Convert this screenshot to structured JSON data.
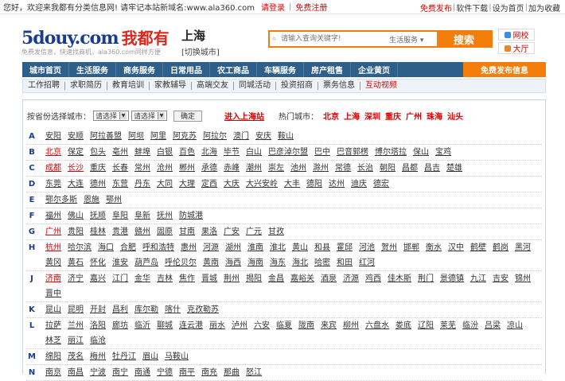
{
  "topbar": {
    "welcome": "您好，欢迎来我都有分类信息网! 请牢记本站新域名:www.ala360.com",
    "login": "请登录",
    "register": "免费注册",
    "links": [
      "免费发布",
      "软件下载",
      "设为首页",
      "加为收藏"
    ]
  },
  "logo": {
    "en": "5douy.com",
    "cn": "我都有",
    "slogan": "免费发信息，快速找商机，ala360.com同样方便"
  },
  "city": {
    "name": "上海",
    "switch": "[切换城市]"
  },
  "search": {
    "placeholder": "请输入查询关键字!",
    "select": "生活服务 ▾",
    "button": "搜索"
  },
  "side_links": {
    "school": "网校",
    "hall": "大厅"
  },
  "nav": {
    "items": [
      "城市首页",
      "生活服务",
      "商务服务",
      "日常用品",
      "农工商品",
      "车辆服务",
      "房产租售",
      "企业黄页"
    ],
    "free_publish": "免费发布信息"
  },
  "subnav": {
    "items": [
      "工作招聘",
      "求职简历",
      "教育培训",
      "家教辅导",
      "高端交友",
      "同城活动",
      "投资招商",
      "票务信息",
      "互动视频"
    ]
  },
  "province": {
    "label": "按省份选择城市：",
    "select1": "请选择",
    "select2": "请选择",
    "ok": "确定",
    "enter": "进入上海站",
    "hot_label": "热门城市：",
    "hot": [
      "北京",
      "上海",
      "深圳",
      "重庆",
      "广州",
      "珠海",
      "汕头"
    ]
  },
  "rows": [
    {
      "letter": "A",
      "cities": [
        "安阳",
        "安顺",
        "阿拉善盟",
        "阿坝",
        "阿里",
        "阿克苏",
        "阿拉尔",
        "澳门",
        "安庆",
        "鞍山"
      ],
      "hl": []
    },
    {
      "letter": "B",
      "cities": [
        "北京",
        "保定",
        "包头",
        "亳州",
        "蚌埠",
        "白银",
        "百色",
        "北海",
        "毕节",
        "白山",
        "巴彦淖尔盟",
        "巴中",
        "巴音郭楞",
        "博尔塔拉",
        "保山",
        "宝鸡"
      ],
      "hl": [
        0
      ]
    },
    {
      "letter": "C",
      "cities": [
        "成都",
        "长沙",
        "重庆",
        "长春",
        "常州",
        "沧州",
        "郴州",
        "承德",
        "赤峰",
        "潮州",
        "崇左",
        "池州",
        "滁州",
        "常德",
        "长治",
        "朝阳",
        "昌都",
        "昌吉",
        "楚雄"
      ],
      "hl": [
        0,
        1
      ]
    },
    {
      "letter": "D",
      "cities": [
        "东莞",
        "大连",
        "德州",
        "东营",
        "丹东",
        "大同",
        "大理",
        "定西",
        "大庆",
        "大兴安岭",
        "大丰",
        "德阳",
        "达州",
        "迪庆",
        "德宏"
      ],
      "hl": []
    },
    {
      "letter": "E",
      "cities": [
        "鄂尔多斯",
        "恩施",
        "鄂州"
      ],
      "hl": []
    },
    {
      "letter": "F",
      "cities": [
        "福州",
        "佛山",
        "抚顺",
        "阜阳",
        "阜新",
        "抚州",
        "防城港"
      ],
      "hl": []
    },
    {
      "letter": "G",
      "cities": [
        "广州",
        "贵阳",
        "桂林",
        "贵港",
        "赣州",
        "固原",
        "甘南",
        "果洛",
        "广安",
        "广元",
        "甘孜"
      ],
      "hl": [
        0
      ]
    },
    {
      "letter": "H",
      "cities": [
        "杭州",
        "哈尔滨",
        "海口",
        "合肥",
        "呼和浩特",
        "惠州",
        "河源",
        "湖州",
        "淮南",
        "淮北",
        "黄山",
        "和县",
        "霍邱",
        "河池",
        "贺州",
        "邯郸",
        "衡水",
        "汉中",
        "鹤壁",
        "鹤岗",
        "黑河",
        "黄冈",
        "黄石",
        "怀化",
        "淮安",
        "葫芦岛",
        "呼伦贝尔",
        "黄南",
        "海西",
        "海南",
        "海东",
        "海北",
        "哈密",
        "和田",
        "红河"
      ],
      "hl": [
        0
      ]
    },
    {
      "letter": "J",
      "cities": [
        "济南",
        "济宁",
        "嘉兴",
        "江门",
        "金华",
        "吉林",
        "焦作",
        "晋城",
        "荆州",
        "揭阳",
        "金昌",
        "嘉峪关",
        "酒泉",
        "济源",
        "鸡西",
        "佳木斯",
        "荆门",
        "景德镇",
        "九江",
        "吉安",
        "锦州",
        "晋中"
      ],
      "hl": [
        0
      ]
    },
    {
      "letter": "K",
      "cities": [
        "昆山",
        "昆明",
        "开封",
        "昌利",
        "库尔勒",
        "喀什",
        "克孜勒苏"
      ],
      "hl": []
    },
    {
      "letter": "L",
      "cities": [
        "拉萨",
        "兰州",
        "洛阳",
        "廊坊",
        "临沂",
        "聊城",
        "连云港",
        "丽水",
        "泸州",
        "六安",
        "临夏",
        "陇南",
        "来宾",
        "柳州",
        "六盘水",
        "娄底",
        "辽阳",
        "莱芜",
        "临汾",
        "吕梁",
        "凉山",
        "林芝",
        "丽江",
        "临沧"
      ],
      "hl": []
    },
    {
      "letter": "M",
      "cities": [
        "绵阳",
        "茂名",
        "梅州",
        "牡丹江",
        "眉山",
        "马鞍山"
      ],
      "hl": []
    },
    {
      "letter": "N",
      "cities": [
        "南京",
        "南昌",
        "宁波",
        "南宁",
        "南通",
        "宁德",
        "南平",
        "南充",
        "那曲",
        "怒江"
      ],
      "hl": []
    }
  ]
}
